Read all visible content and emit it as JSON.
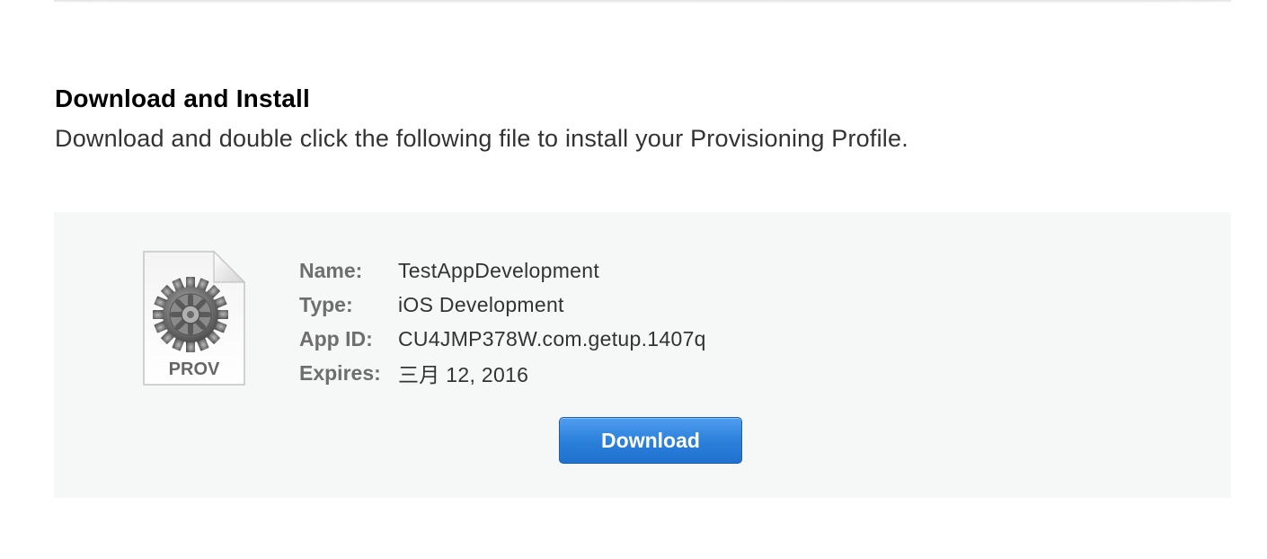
{
  "section": {
    "title": "Download and Install",
    "description": "Download and double click the following file to install your Provisioning Profile."
  },
  "profile": {
    "file_icon": {
      "icon": "gear-icon",
      "label": "PROV"
    },
    "fields": [
      {
        "label": "Name:",
        "value": "TestAppDevelopment"
      },
      {
        "label": "Type:",
        "value": "iOS Development"
      },
      {
        "label": "App ID:",
        "value": "CU4JMP378W.com.getup.1407q"
      },
      {
        "label": "Expires:",
        "value": "三月 12, 2016"
      }
    ],
    "download_label": "Download"
  },
  "colors": {
    "panel_background": "#f6f8f7",
    "button_blue": "#2a7fd9",
    "label_gray": "#6e6e6e"
  }
}
